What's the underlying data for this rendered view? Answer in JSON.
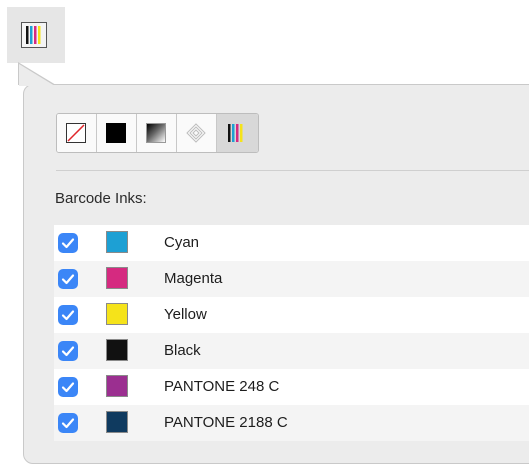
{
  "trigger": {
    "icon": "barcode-inks-icon"
  },
  "mode_buttons": [
    {
      "name": "none-mode-button",
      "icon": "none-slash-icon",
      "selected": false
    },
    {
      "name": "solid-mode-button",
      "icon": "solid-fill-icon",
      "selected": false
    },
    {
      "name": "gradient-mode-button",
      "icon": "gradient-icon",
      "selected": false
    },
    {
      "name": "pattern-mode-button",
      "icon": "pattern-icon",
      "selected": false
    },
    {
      "name": "inks-mode-button",
      "icon": "barcode-inks-icon",
      "selected": true
    }
  ],
  "section_label": "Barcode Inks:",
  "inks": [
    {
      "name": "Cyan",
      "color": "#1da0d4",
      "checked": true
    },
    {
      "name": "Magenta",
      "color": "#d52a80",
      "checked": true
    },
    {
      "name": "Yellow",
      "color": "#f5e31a",
      "checked": true
    },
    {
      "name": "Black",
      "color": "#111111",
      "checked": true
    },
    {
      "name": "PANTONE 248 C",
      "color": "#9b2f90",
      "checked": true
    },
    {
      "name": "PANTONE 2188 C",
      "color": "#0f3a5f",
      "checked": true
    }
  ],
  "colors": {
    "accent": "#3b86f7",
    "popover_bg": "#ececec"
  }
}
